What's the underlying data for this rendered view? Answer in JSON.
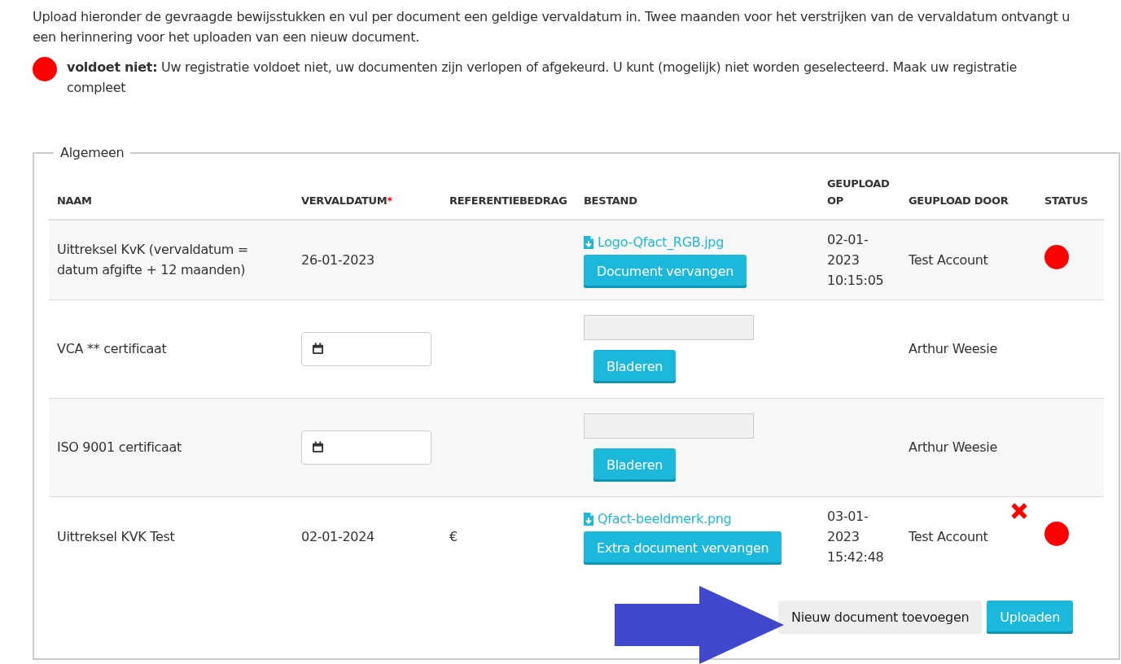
{
  "intro": "Upload hieronder de gevraagde bewijsstukken en vul per document een geldige vervaldatum in. Twee maanden voor het verstrijken van de vervaldatum ontvangt u een herinnering voor het uploaden van een nieuw document.",
  "legend": {
    "color": "#ff0000",
    "text": "**voldoet niet:** Uw registratie voldoet niet, uw documenten zijn verlopen of afgekeurd. U kunt (mogelijk) niet worden geselecteerd. Maak uw registratie compleet"
  },
  "section": {
    "title": "Algemeen",
    "columns": [
      {
        "label": "NAAM"
      },
      {
        "label": "VERVALDATUM",
        "required_mark": "*"
      },
      {
        "label": "REFERENTIEBEDRAG"
      },
      {
        "label": "BESTAND"
      },
      {
        "label": "GEUPLOAD OP"
      },
      {
        "label": "GEUPLOAD DOOR"
      },
      {
        "label": "STATUS"
      }
    ],
    "rows": [
      {
        "kind": "uploaded",
        "name": "Uittreksel KvK (vervaldatum = datum afgifte + 12 maanden)",
        "expiry": "26-01-2023",
        "file": "Logo-Qfact_RGB.jpg",
        "button": "Document vervangen",
        "uploaded_on": "02-01-2023 10:15:05",
        "uploaded_by": "Test Account",
        "color": "#ff0000",
        "deletable": false
      },
      {
        "kind": "empty",
        "name": "VCA ** certificaat",
        "button": "Bladeren",
        "uploaded_by": "Arthur Weesie"
      },
      {
        "kind": "empty",
        "name": "ISO 9001 certificaat",
        "button": "Bladeren",
        "uploaded_by": "Arthur Weesie"
      },
      {
        "kind": "uploaded",
        "name": "Uittreksel KVK Test",
        "expiry": "02-01-2024",
        "amount": "€",
        "file": "Qfact-beeldmerk.png",
        "button": "Extra document vervangen",
        "uploaded_on": "03-01-2023 15:42:48",
        "uploaded_by": "Test Account",
        "color": "#ff0000",
        "deletable": true
      }
    ],
    "buttons": [
      {
        "kind": "secondary",
        "label": "Nieuw document toevoegen"
      },
      {
        "kind": "primary",
        "label": "Uploaden"
      }
    ]
  }
}
